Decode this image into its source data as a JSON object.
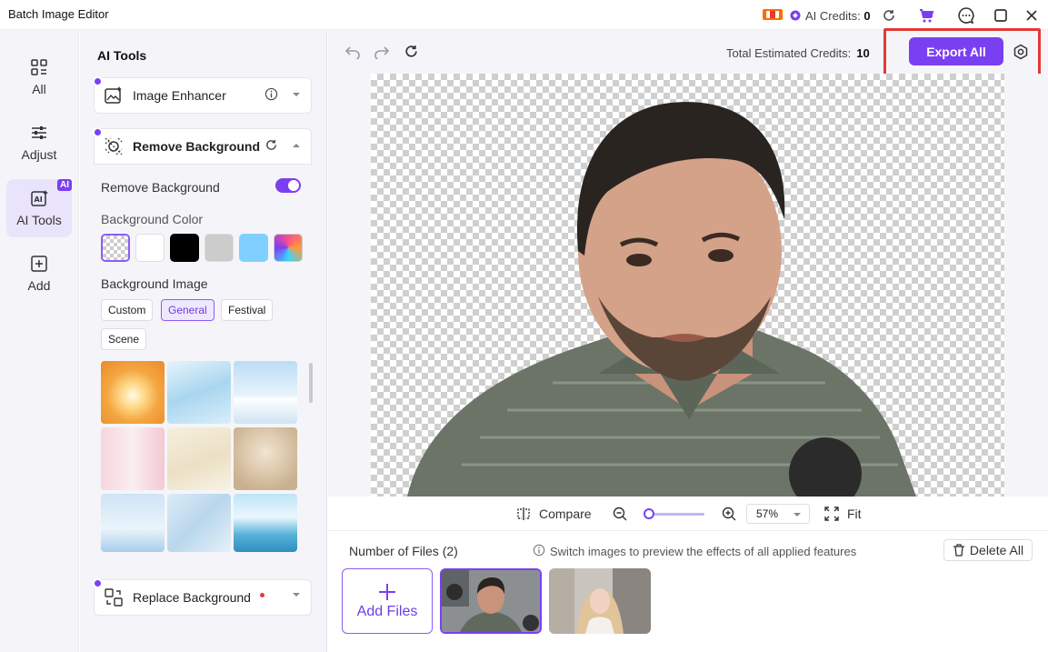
{
  "app": {
    "title": "Batch Image Editor"
  },
  "titlebar": {
    "credits_label": "AI Credits:",
    "credits_value": "0",
    "icons": [
      "credits-badge-icon",
      "refresh-icon",
      "cart-icon",
      "chat-icon",
      "maximize-icon",
      "close-icon"
    ]
  },
  "rail": {
    "items": [
      {
        "label": "All",
        "icon": "grid-icon"
      },
      {
        "label": "Adjust",
        "icon": "sliders-icon"
      },
      {
        "label": "AI Tools",
        "icon": "ai-icon",
        "badge": "AI",
        "active": true
      },
      {
        "label": "Add",
        "icon": "plus-square-icon"
      }
    ]
  },
  "panel": {
    "title": "AI Tools",
    "image_enhancer": {
      "label": "Image Enhancer"
    },
    "remove_background": {
      "label": "Remove Background",
      "toggle_label": "Remove Background",
      "toggle_on": true,
      "bg_color_label": "Background Color",
      "colors": [
        "transparent",
        "#ffffff",
        "#000000",
        "#cccccc",
        "#7fd0ff",
        "gradient"
      ],
      "bg_image_label": "Background Image",
      "categories": [
        "Custom",
        "General",
        "Festival",
        "Scene"
      ],
      "active_category": "General"
    },
    "replace_background": {
      "label": "Replace Background"
    }
  },
  "main": {
    "total_label": "Total Estimated Credits:",
    "total_value": "10",
    "export_label": "Export All",
    "compare_label": "Compare",
    "zoom_value": "57%",
    "fit_label": "Fit",
    "zoom_level": 0.05
  },
  "files": {
    "count_label": "Number of Files (2)",
    "hint": "Switch images to preview the effects of all applied features",
    "delete_label": "Delete All",
    "add_label": "Add Files"
  },
  "colors": {
    "accent": "#7b3ff2",
    "highlight": "#e53935"
  }
}
